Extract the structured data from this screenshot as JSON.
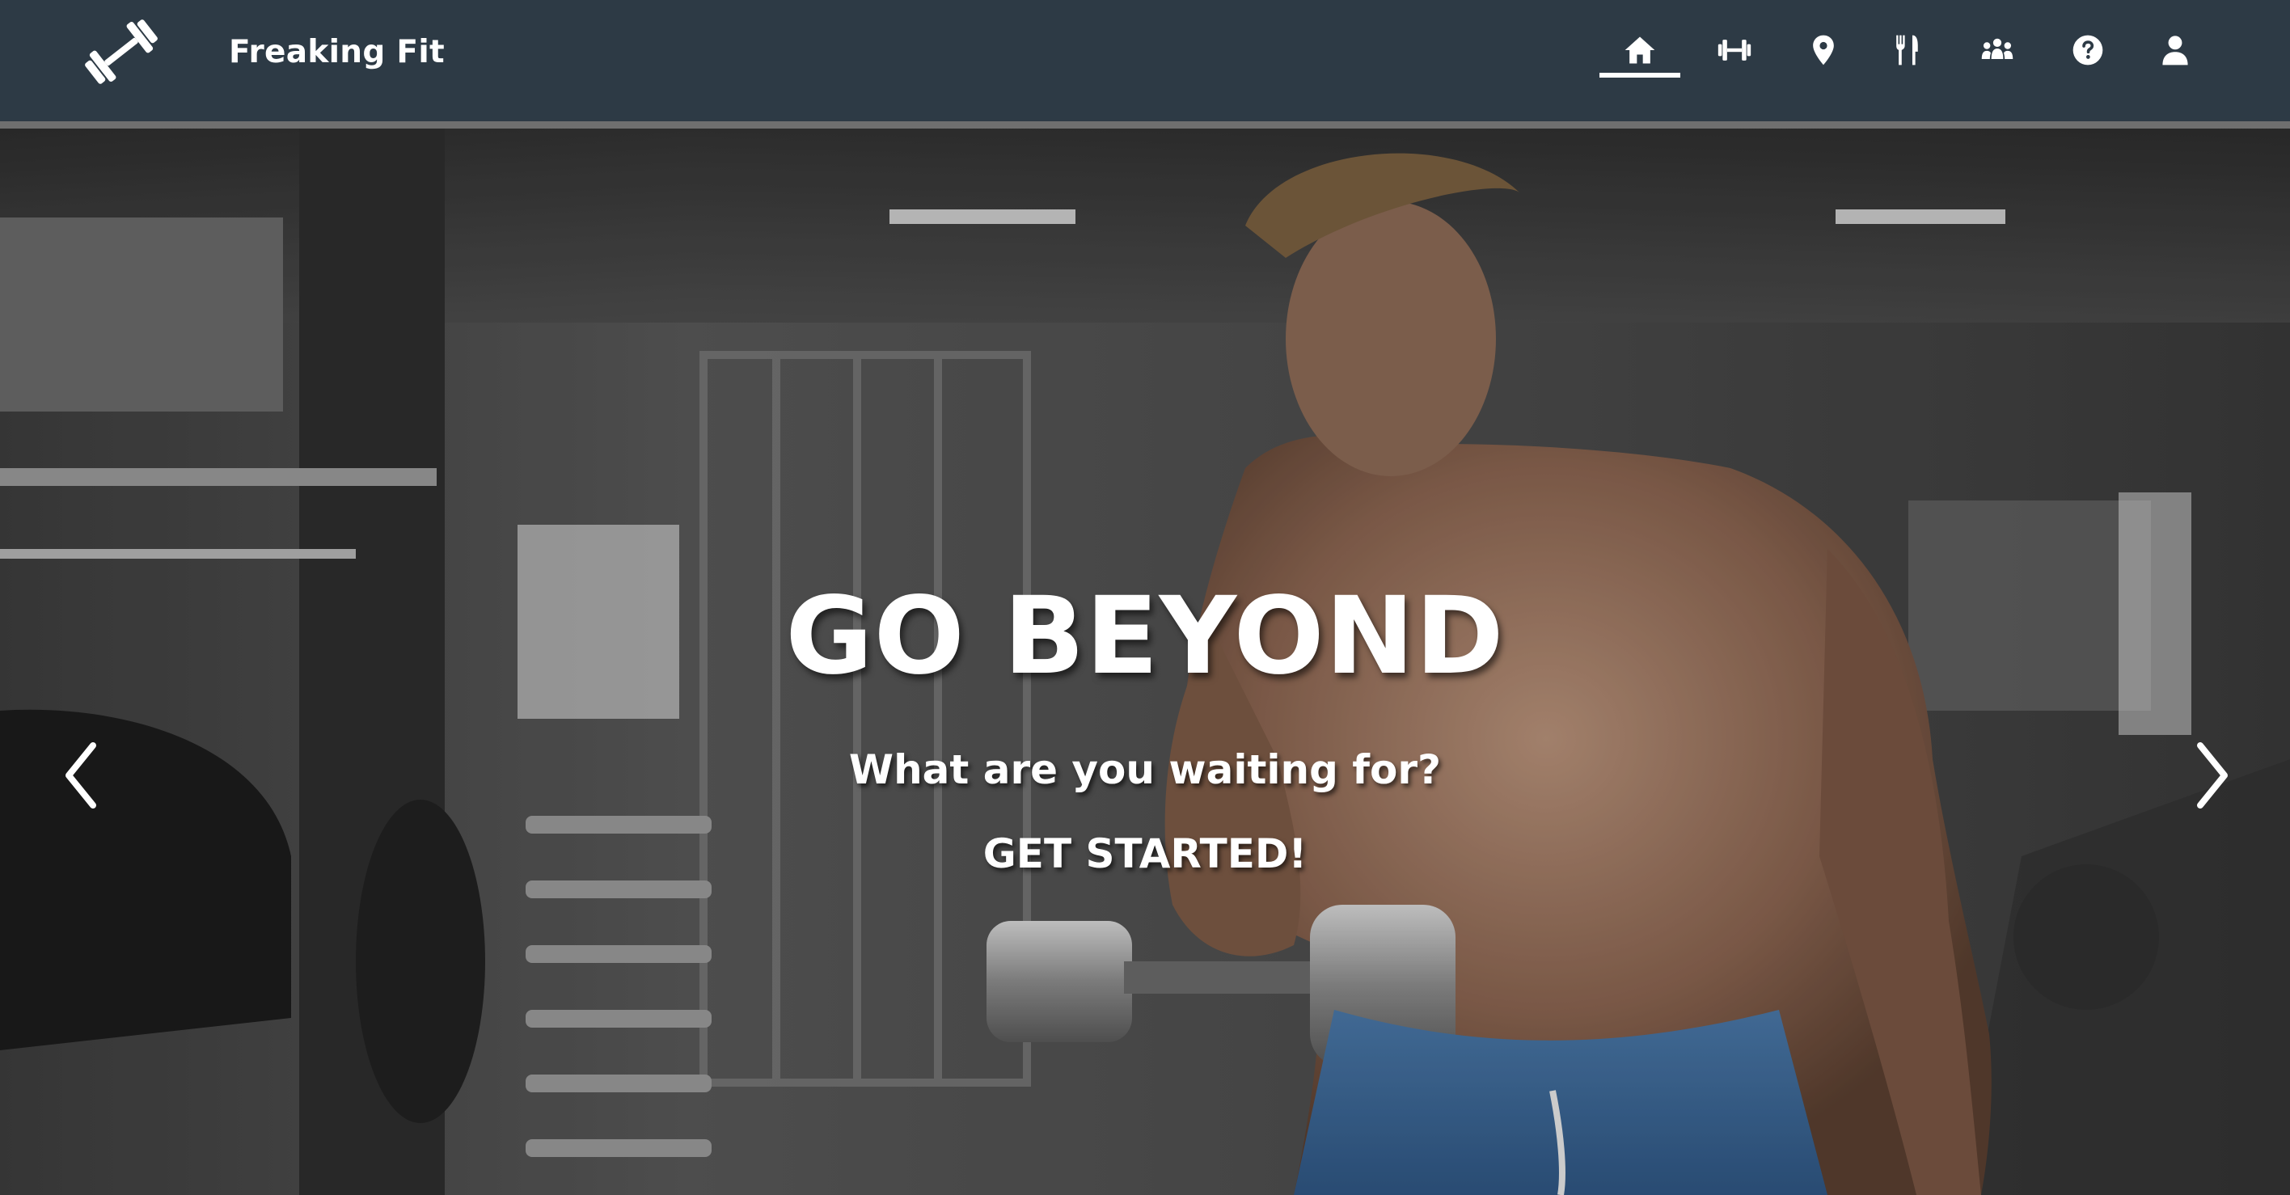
{
  "brand": {
    "name": "Freaking Fit",
    "logo_icon": "dumbbell-icon"
  },
  "nav": {
    "items": [
      {
        "id": "home",
        "icon": "home-icon",
        "active": true
      },
      {
        "id": "workouts",
        "icon": "dumbbell-icon",
        "active": false
      },
      {
        "id": "locations",
        "icon": "map-pin-icon",
        "active": false
      },
      {
        "id": "nutrition",
        "icon": "fork-knife-icon",
        "active": false
      },
      {
        "id": "community",
        "icon": "group-icon",
        "active": false
      },
      {
        "id": "help",
        "icon": "help-icon",
        "active": false
      },
      {
        "id": "account",
        "icon": "user-icon",
        "active": false
      }
    ]
  },
  "hero": {
    "title": "GO BEYOND",
    "subtitle": "What are you waiting for?",
    "cta_label": "GET STARTED!",
    "prev_icon": "chevron-left-icon",
    "next_icon": "chevron-right-icon"
  },
  "colors": {
    "navbar_bg": "#2d3a45",
    "navbar_border": "#6f6f6f",
    "text": "#ffffff"
  }
}
